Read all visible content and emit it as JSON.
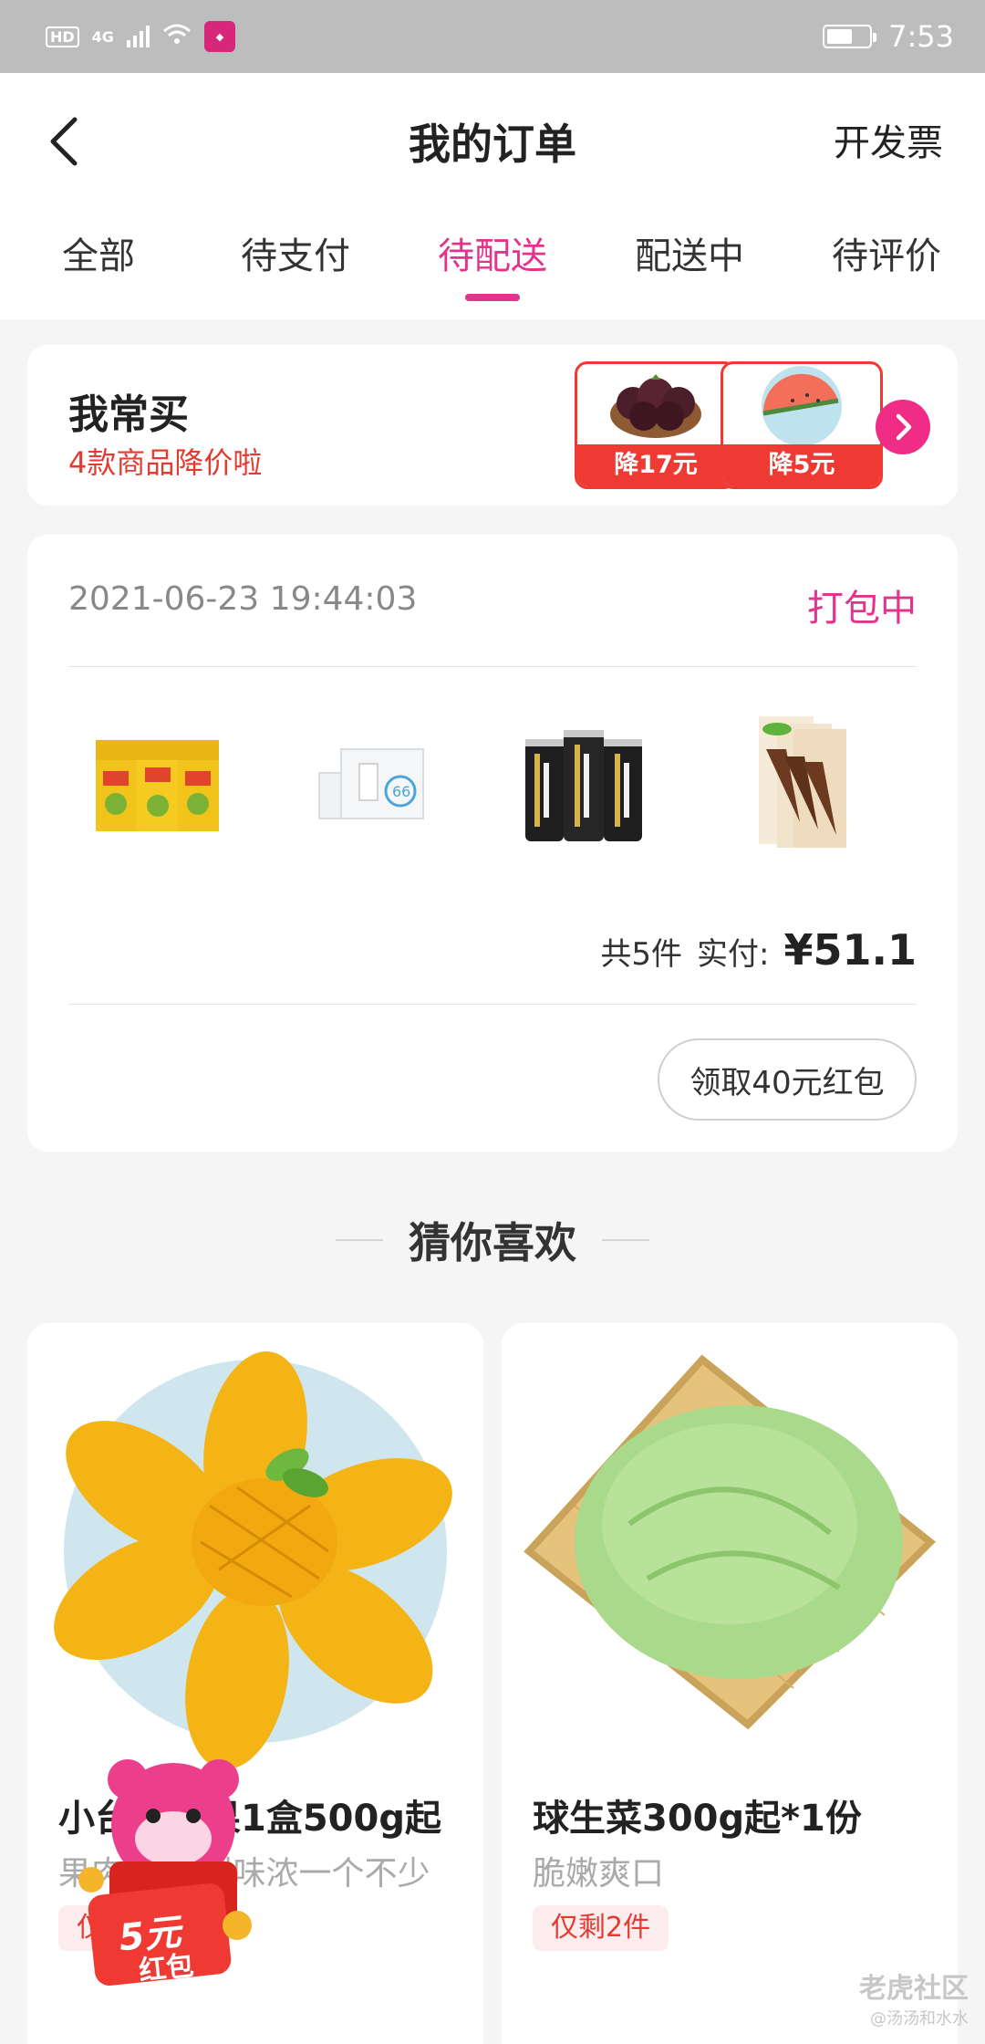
{
  "status_bar": {
    "hd": "HD",
    "network": "4G",
    "time": "7:53",
    "battery_level": 0.6
  },
  "header": {
    "title": "我的订单",
    "action": "开发票"
  },
  "tabs": [
    {
      "label": "全部"
    },
    {
      "label": "待支付"
    },
    {
      "label": "待配送"
    },
    {
      "label": "配送中"
    },
    {
      "label": "待评价"
    }
  ],
  "active_tab": "待配送",
  "frequently_bought": {
    "title": "我常买",
    "subtitle": "4款商品降价啦",
    "deals": [
      {
        "price_drop": "降17元",
        "image": "mangosteen"
      },
      {
        "price_drop": "降5元",
        "image": "watermelon"
      }
    ]
  },
  "order": {
    "time": "2021-06-23 19:44:03",
    "status": "打包中",
    "products": [
      "lemon-tea-pack",
      "milk-box",
      "watsons-soda-cans",
      "ice-cream-cones"
    ],
    "count_text": "共5件",
    "paid_label": "实付:",
    "paid_amount": "¥51.1",
    "redpacket_button": "领取40元红包"
  },
  "guess": {
    "title": "猜你喜欢",
    "items": [
      {
        "name": "小台农芒果1盒500g起",
        "desc": "果肉细腻 甜味浓一个不少",
        "tag": "仅剩",
        "image": "mango"
      },
      {
        "name": "球生菜300g起*1份",
        "desc": "脆嫩爽口",
        "tag": "仅剩2件",
        "image": "lettuce"
      }
    ]
  },
  "floating_packet": {
    "amount": "5元",
    "label": "红包"
  },
  "watermark": {
    "main": "老虎社区",
    "sub": "@汤汤和水水"
  },
  "colors": {
    "accent": "#e2348c",
    "red": "#ee3a32",
    "status_bar": "#bdbdbd"
  }
}
